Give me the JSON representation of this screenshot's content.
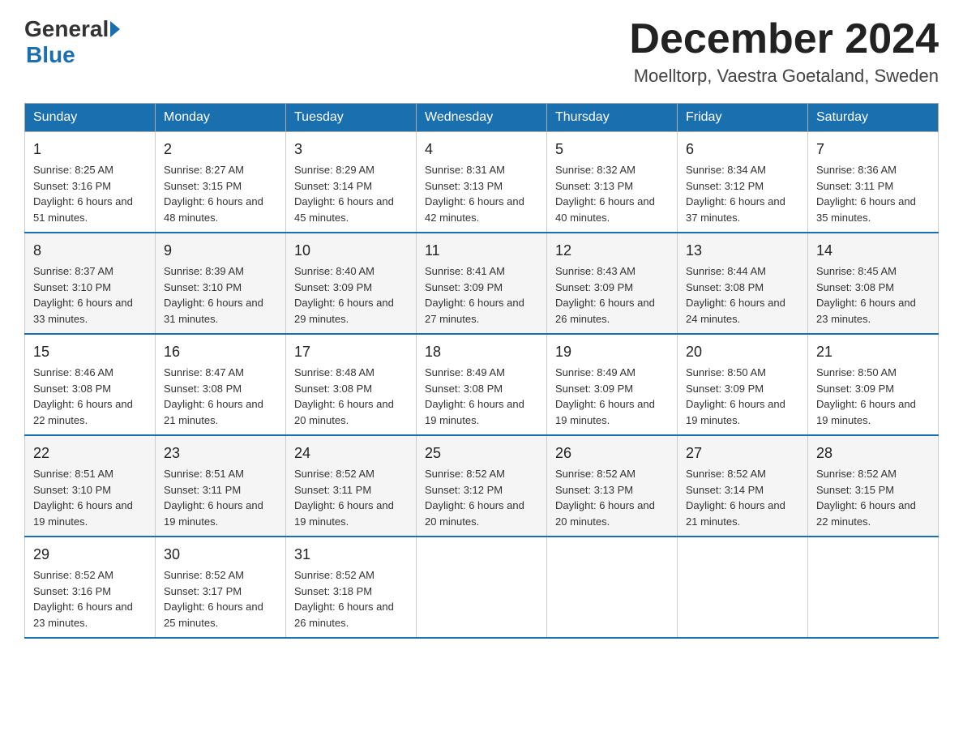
{
  "header": {
    "logo_general": "General",
    "logo_blue": "Blue",
    "month_title": "December 2024",
    "location": "Moelltorp, Vaestra Goetaland, Sweden"
  },
  "days_of_week": [
    "Sunday",
    "Monday",
    "Tuesday",
    "Wednesday",
    "Thursday",
    "Friday",
    "Saturday"
  ],
  "weeks": [
    [
      {
        "day": "1",
        "sunrise": "Sunrise: 8:25 AM",
        "sunset": "Sunset: 3:16 PM",
        "daylight": "Daylight: 6 hours and 51 minutes."
      },
      {
        "day": "2",
        "sunrise": "Sunrise: 8:27 AM",
        "sunset": "Sunset: 3:15 PM",
        "daylight": "Daylight: 6 hours and 48 minutes."
      },
      {
        "day": "3",
        "sunrise": "Sunrise: 8:29 AM",
        "sunset": "Sunset: 3:14 PM",
        "daylight": "Daylight: 6 hours and 45 minutes."
      },
      {
        "day": "4",
        "sunrise": "Sunrise: 8:31 AM",
        "sunset": "Sunset: 3:13 PM",
        "daylight": "Daylight: 6 hours and 42 minutes."
      },
      {
        "day": "5",
        "sunrise": "Sunrise: 8:32 AM",
        "sunset": "Sunset: 3:13 PM",
        "daylight": "Daylight: 6 hours and 40 minutes."
      },
      {
        "day": "6",
        "sunrise": "Sunrise: 8:34 AM",
        "sunset": "Sunset: 3:12 PM",
        "daylight": "Daylight: 6 hours and 37 minutes."
      },
      {
        "day": "7",
        "sunrise": "Sunrise: 8:36 AM",
        "sunset": "Sunset: 3:11 PM",
        "daylight": "Daylight: 6 hours and 35 minutes."
      }
    ],
    [
      {
        "day": "8",
        "sunrise": "Sunrise: 8:37 AM",
        "sunset": "Sunset: 3:10 PM",
        "daylight": "Daylight: 6 hours and 33 minutes."
      },
      {
        "day": "9",
        "sunrise": "Sunrise: 8:39 AM",
        "sunset": "Sunset: 3:10 PM",
        "daylight": "Daylight: 6 hours and 31 minutes."
      },
      {
        "day": "10",
        "sunrise": "Sunrise: 8:40 AM",
        "sunset": "Sunset: 3:09 PM",
        "daylight": "Daylight: 6 hours and 29 minutes."
      },
      {
        "day": "11",
        "sunrise": "Sunrise: 8:41 AM",
        "sunset": "Sunset: 3:09 PM",
        "daylight": "Daylight: 6 hours and 27 minutes."
      },
      {
        "day": "12",
        "sunrise": "Sunrise: 8:43 AM",
        "sunset": "Sunset: 3:09 PM",
        "daylight": "Daylight: 6 hours and 26 minutes."
      },
      {
        "day": "13",
        "sunrise": "Sunrise: 8:44 AM",
        "sunset": "Sunset: 3:08 PM",
        "daylight": "Daylight: 6 hours and 24 minutes."
      },
      {
        "day": "14",
        "sunrise": "Sunrise: 8:45 AM",
        "sunset": "Sunset: 3:08 PM",
        "daylight": "Daylight: 6 hours and 23 minutes."
      }
    ],
    [
      {
        "day": "15",
        "sunrise": "Sunrise: 8:46 AM",
        "sunset": "Sunset: 3:08 PM",
        "daylight": "Daylight: 6 hours and 22 minutes."
      },
      {
        "day": "16",
        "sunrise": "Sunrise: 8:47 AM",
        "sunset": "Sunset: 3:08 PM",
        "daylight": "Daylight: 6 hours and 21 minutes."
      },
      {
        "day": "17",
        "sunrise": "Sunrise: 8:48 AM",
        "sunset": "Sunset: 3:08 PM",
        "daylight": "Daylight: 6 hours and 20 minutes."
      },
      {
        "day": "18",
        "sunrise": "Sunrise: 8:49 AM",
        "sunset": "Sunset: 3:08 PM",
        "daylight": "Daylight: 6 hours and 19 minutes."
      },
      {
        "day": "19",
        "sunrise": "Sunrise: 8:49 AM",
        "sunset": "Sunset: 3:09 PM",
        "daylight": "Daylight: 6 hours and 19 minutes."
      },
      {
        "day": "20",
        "sunrise": "Sunrise: 8:50 AM",
        "sunset": "Sunset: 3:09 PM",
        "daylight": "Daylight: 6 hours and 19 minutes."
      },
      {
        "day": "21",
        "sunrise": "Sunrise: 8:50 AM",
        "sunset": "Sunset: 3:09 PM",
        "daylight": "Daylight: 6 hours and 19 minutes."
      }
    ],
    [
      {
        "day": "22",
        "sunrise": "Sunrise: 8:51 AM",
        "sunset": "Sunset: 3:10 PM",
        "daylight": "Daylight: 6 hours and 19 minutes."
      },
      {
        "day": "23",
        "sunrise": "Sunrise: 8:51 AM",
        "sunset": "Sunset: 3:11 PM",
        "daylight": "Daylight: 6 hours and 19 minutes."
      },
      {
        "day": "24",
        "sunrise": "Sunrise: 8:52 AM",
        "sunset": "Sunset: 3:11 PM",
        "daylight": "Daylight: 6 hours and 19 minutes."
      },
      {
        "day": "25",
        "sunrise": "Sunrise: 8:52 AM",
        "sunset": "Sunset: 3:12 PM",
        "daylight": "Daylight: 6 hours and 20 minutes."
      },
      {
        "day": "26",
        "sunrise": "Sunrise: 8:52 AM",
        "sunset": "Sunset: 3:13 PM",
        "daylight": "Daylight: 6 hours and 20 minutes."
      },
      {
        "day": "27",
        "sunrise": "Sunrise: 8:52 AM",
        "sunset": "Sunset: 3:14 PM",
        "daylight": "Daylight: 6 hours and 21 minutes."
      },
      {
        "day": "28",
        "sunrise": "Sunrise: 8:52 AM",
        "sunset": "Sunset: 3:15 PM",
        "daylight": "Daylight: 6 hours and 22 minutes."
      }
    ],
    [
      {
        "day": "29",
        "sunrise": "Sunrise: 8:52 AM",
        "sunset": "Sunset: 3:16 PM",
        "daylight": "Daylight: 6 hours and 23 minutes."
      },
      {
        "day": "30",
        "sunrise": "Sunrise: 8:52 AM",
        "sunset": "Sunset: 3:17 PM",
        "daylight": "Daylight: 6 hours and 25 minutes."
      },
      {
        "day": "31",
        "sunrise": "Sunrise: 8:52 AM",
        "sunset": "Sunset: 3:18 PM",
        "daylight": "Daylight: 6 hours and 26 minutes."
      },
      null,
      null,
      null,
      null
    ]
  ]
}
